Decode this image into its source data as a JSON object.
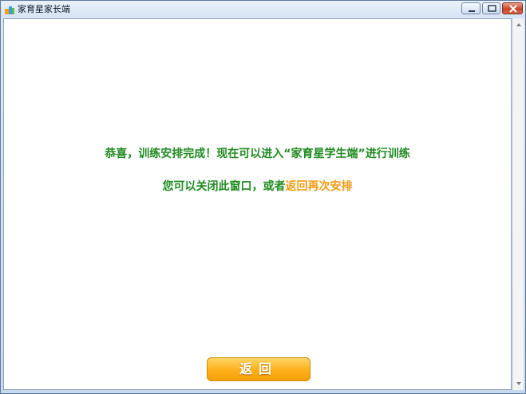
{
  "window": {
    "title": "家育星家长端",
    "icon": "app-logo-icon",
    "controls": [
      "minimize-icon",
      "maximize-icon",
      "close-icon"
    ]
  },
  "message": {
    "line1": "恭喜，训练安排完成！现在可以进入“家育星学生端”进行训练",
    "line2_prefix": "您可以关闭此窗口，或者",
    "line2_link": "返回再次安排"
  },
  "buttons": {
    "back_label": "返回"
  },
  "colors": {
    "message_text": "#1f8a1f",
    "link_text": "#f39a12",
    "button_bg": "#ffb21f"
  }
}
